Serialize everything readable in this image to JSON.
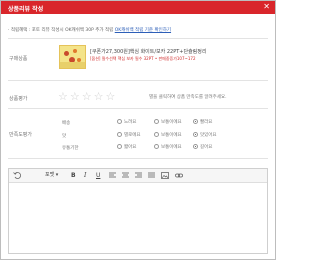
{
  "window": {
    "title": "상품리뷰 작성",
    "close_label": "✕"
  },
  "notice": {
    "text": "· 적립혜택 : 포토 리뷰 작성시 OK캐쉬백 30P 추가 적립",
    "link": "OK캐쉬백 적립 기준 확인하기"
  },
  "product": {
    "label": "구매상품",
    "name_line1": "[쿠폰가27,300원]핵심 화이트/보카 22PT+단슐림정리",
    "name_line2": "[옵션] 필수선택 핵심 보카 필수 32PT • 판매중증가107~172"
  },
  "rating": {
    "label": "상품평가",
    "stars": [
      "☆",
      "☆",
      "☆",
      "☆",
      "☆"
    ],
    "hint": "별을 클릭하여 상품 만족도를 알려주세요."
  },
  "satisfaction": {
    "label": "만족도평가",
    "rows": [
      {
        "name": "배송",
        "options": [
          "느려요",
          "보통이에요",
          "빨라요"
        ],
        "selected": 2
      },
      {
        "name": "맛",
        "options": [
          "별로에요",
          "보통이에요",
          "맛있어요"
        ],
        "selected": 2
      },
      {
        "name": "유통기한",
        "options": [
          "짧아요",
          "보통이에요",
          "길어요"
        ],
        "selected": 2
      }
    ]
  },
  "editor": {
    "font_label": "포맷",
    "font_arrow": "▾",
    "bold": "B",
    "italic": "I",
    "underline": "U"
  }
}
